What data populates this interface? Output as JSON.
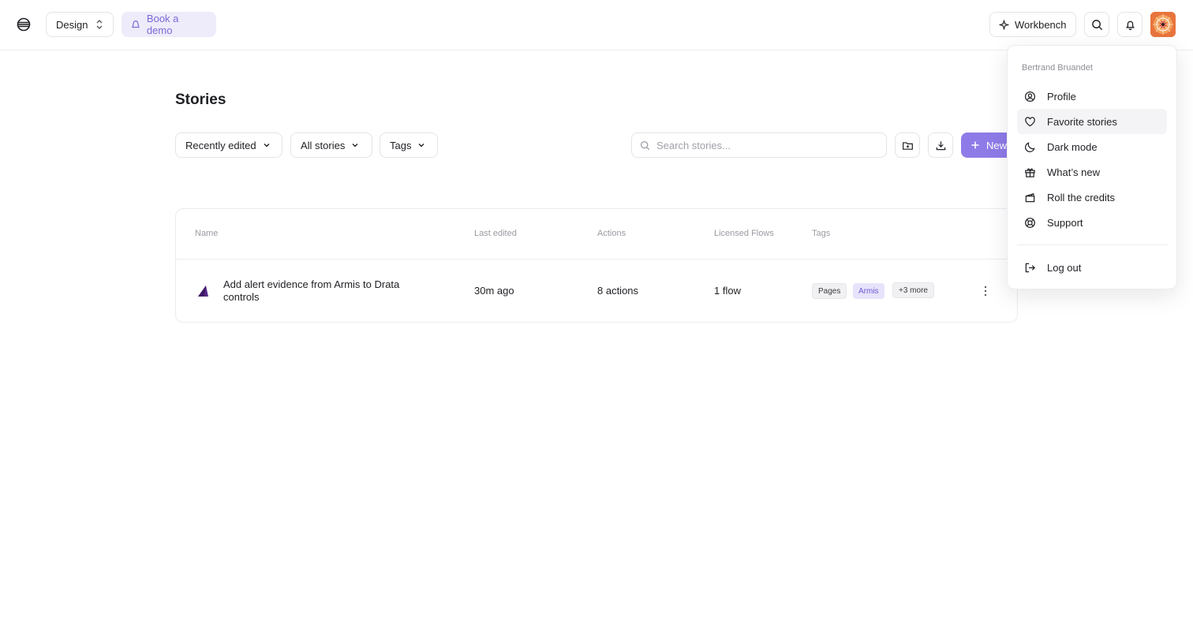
{
  "header": {
    "workspace": "Design",
    "book_demo": "Book a demo",
    "workbench": "Workbench"
  },
  "page": {
    "title": "Stories"
  },
  "filters": {
    "sort": "Recently edited",
    "scope": "All stories",
    "tags": "Tags"
  },
  "search": {
    "placeholder": "Search stories..."
  },
  "new_button": "New",
  "table": {
    "columns": [
      "Name",
      "Last edited",
      "Actions",
      "Licensed Flows",
      "Tags"
    ],
    "rows": [
      {
        "name": "Add alert evidence from Armis to Drata controls",
        "last_edited": "30m ago",
        "actions": "8 actions",
        "licensed_flows": "1 flow",
        "tags": [
          "Pages",
          "Armis"
        ],
        "more_tags": "+3 more"
      }
    ]
  },
  "menu": {
    "user": "Bertrand Bruandet",
    "items": [
      {
        "label": "Profile",
        "icon": "user-circle-icon"
      },
      {
        "label": "Favorite stories",
        "icon": "heart-icon"
      },
      {
        "label": "Dark mode",
        "icon": "moon-icon"
      },
      {
        "label": "What’s new",
        "icon": "gift-icon"
      },
      {
        "label": "Roll the credits",
        "icon": "clapperboard-icon"
      },
      {
        "label": "Support",
        "icon": "lifebuoy-icon"
      }
    ],
    "logout": "Log out"
  },
  "colors": {
    "accent": "#8f7be8",
    "demo_bg": "#eeecfa",
    "armis_tag_bg": "#e6e3fb",
    "armis_tag_fg": "#6e5ad3"
  }
}
